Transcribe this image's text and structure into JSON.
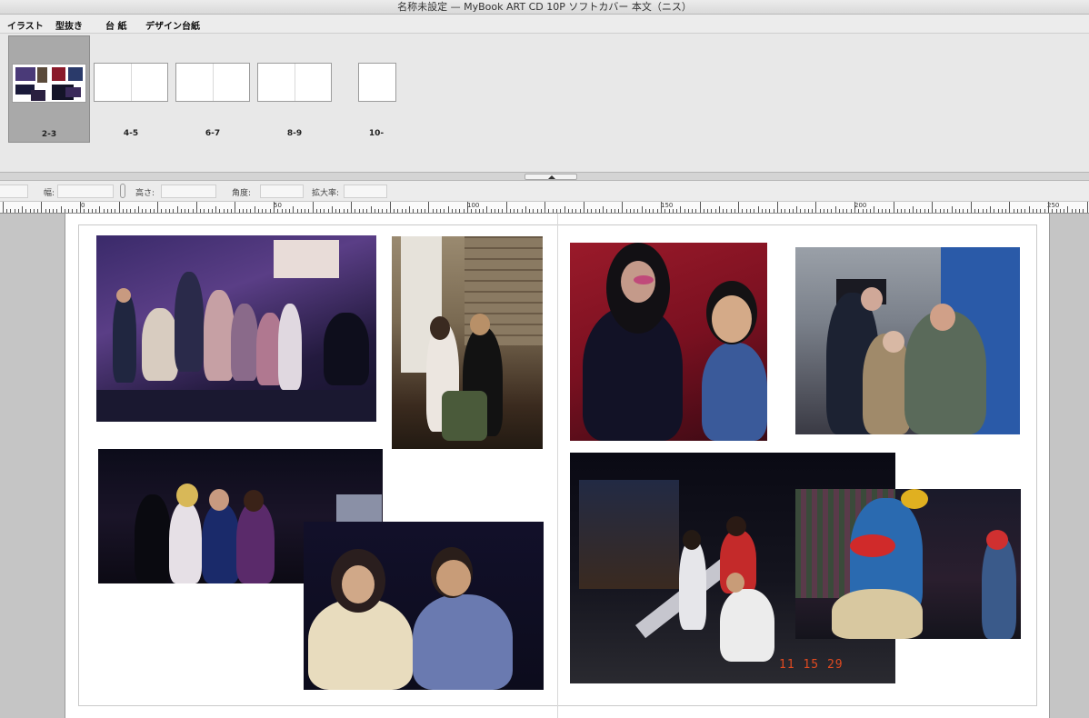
{
  "window": {
    "title": "名称未設定 — MyBook ART CD 10P ソフトカバー 本文（ニス）"
  },
  "menu": {
    "items": [
      "イラスト",
      "型抜き",
      "台 紙",
      "デザイン台紙"
    ]
  },
  "pages": [
    {
      "label": "2-3",
      "selected": true
    },
    {
      "label": "4-5",
      "selected": false
    },
    {
      "label": "6-7",
      "selected": false
    },
    {
      "label": "8-9",
      "selected": false
    },
    {
      "label": "10-",
      "selected": false
    }
  ],
  "properties": {
    "width_label": "幅:",
    "height_label": "高さ:",
    "angle_label": "角度:",
    "scale_label": "拡大率:"
  },
  "ruler": {
    "labels": [
      "0",
      "50",
      "100",
      "150",
      "200",
      "250"
    ]
  },
  "photos": {
    "timestamp": "11 15 29"
  }
}
